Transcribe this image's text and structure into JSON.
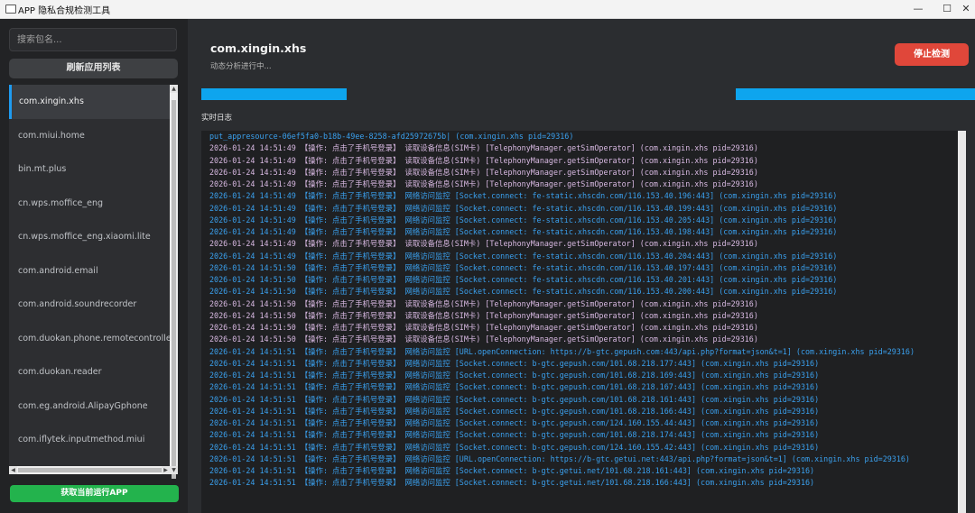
{
  "window": {
    "title": "APP 隐私合规检测工具",
    "controls": {
      "minimize": "—",
      "maximize": "☐",
      "close": "✕"
    }
  },
  "sidebar": {
    "search_placeholder": "搜索包名...",
    "refresh_label": "刷新应用列表",
    "apps": [
      "com.xingin.xhs",
      "com.miui.home",
      "bin.mt.plus",
      "cn.wps.moffice_eng",
      "cn.wps.moffice_eng.xiaomi.lite",
      "com.android.email",
      "com.android.soundrecorder",
      "com.duokan.phone.remotecontroller",
      "com.duokan.reader",
      "com.eg.android.AlipayGphone",
      "com.iflytek.inputmethod.miui"
    ],
    "selected_index": 0,
    "run_app_label": "获取当前运行APP"
  },
  "main": {
    "package": "com.xingin.xhs",
    "status": "动态分析进行中...",
    "stop_label": "停止检测",
    "log_label": "实时日志",
    "logs": [
      {
        "kind": "net",
        "text": "put_appresource-06ef5fa0-b18b-49ee-8258-afd25972675b| (com.xingin.xhs pid=29316)"
      },
      {
        "kind": "dev",
        "text": "2026-01-24 14:51:49 【操作: 点击了手机号登录】 读取设备信息(SIM卡) [TelephonyManager.getSimOperator] (com.xingin.xhs pid=29316)"
      },
      {
        "kind": "dev",
        "text": "2026-01-24 14:51:49 【操作: 点击了手机号登录】 读取设备信息(SIM卡) [TelephonyManager.getSimOperator] (com.xingin.xhs pid=29316)"
      },
      {
        "kind": "dev",
        "text": "2026-01-24 14:51:49 【操作: 点击了手机号登录】 读取设备信息(SIM卡) [TelephonyManager.getSimOperator] (com.xingin.xhs pid=29316)"
      },
      {
        "kind": "dev",
        "text": "2026-01-24 14:51:49 【操作: 点击了手机号登录】 读取设备信息(SIM卡) [TelephonyManager.getSimOperator] (com.xingin.xhs pid=29316)"
      },
      {
        "kind": "net",
        "text": "2026-01-24 14:51:49 【操作: 点击了手机号登录】 网络访问监控 [Socket.connect: fe-static.xhscdn.com/116.153.40.196:443] (com.xingin.xhs pid=29316)"
      },
      {
        "kind": "net",
        "text": "2026-01-24 14:51:49 【操作: 点击了手机号登录】 网络访问监控 [Socket.connect: fe-static.xhscdn.com/116.153.40.199:443] (com.xingin.xhs pid=29316)"
      },
      {
        "kind": "net",
        "text": "2026-01-24 14:51:49 【操作: 点击了手机号登录】 网络访问监控 [Socket.connect: fe-static.xhscdn.com/116.153.40.205:443] (com.xingin.xhs pid=29316)"
      },
      {
        "kind": "net",
        "text": "2026-01-24 14:51:49 【操作: 点击了手机号登录】 网络访问监控 [Socket.connect: fe-static.xhscdn.com/116.153.40.198:443] (com.xingin.xhs pid=29316)"
      },
      {
        "kind": "dev",
        "text": "2026-01-24 14:51:49 【操作: 点击了手机号登录】 读取设备信息(SIM卡) [TelephonyManager.getSimOperator] (com.xingin.xhs pid=29316)"
      },
      {
        "kind": "net",
        "text": "2026-01-24 14:51:49 【操作: 点击了手机号登录】 网络访问监控 [Socket.connect: fe-static.xhscdn.com/116.153.40.204:443] (com.xingin.xhs pid=29316)"
      },
      {
        "kind": "net",
        "text": "2026-01-24 14:51:50 【操作: 点击了手机号登录】 网络访问监控 [Socket.connect: fe-static.xhscdn.com/116.153.40.197:443] (com.xingin.xhs pid=29316)"
      },
      {
        "kind": "net",
        "text": "2026-01-24 14:51:50 【操作: 点击了手机号登录】 网络访问监控 [Socket.connect: fe-static.xhscdn.com/116.153.40.201:443] (com.xingin.xhs pid=29316)"
      },
      {
        "kind": "net",
        "text": "2026-01-24 14:51:50 【操作: 点击了手机号登录】 网络访问监控 [Socket.connect: fe-static.xhscdn.com/116.153.40.200:443] (com.xingin.xhs pid=29316)"
      },
      {
        "kind": "dev",
        "text": "2026-01-24 14:51:50 【操作: 点击了手机号登录】 读取设备信息(SIM卡) [TelephonyManager.getSimOperator] (com.xingin.xhs pid=29316)"
      },
      {
        "kind": "dev",
        "text": "2026-01-24 14:51:50 【操作: 点击了手机号登录】 读取设备信息(SIM卡) [TelephonyManager.getSimOperator] (com.xingin.xhs pid=29316)"
      },
      {
        "kind": "dev",
        "text": "2026-01-24 14:51:50 【操作: 点击了手机号登录】 读取设备信息(SIM卡) [TelephonyManager.getSimOperator] (com.xingin.xhs pid=29316)"
      },
      {
        "kind": "dev",
        "text": "2026-01-24 14:51:50 【操作: 点击了手机号登录】 读取设备信息(SIM卡) [TelephonyManager.getSimOperator] (com.xingin.xhs pid=29316)"
      },
      {
        "kind": "net",
        "wrap": true,
        "text": "2026-01-24 14:51:51 【操作: 点击了手机号登录】 网络访问监控 [URL.openConnection: https://b-gtc.gepush.com:443/api.php?format=json&t=1] (com.xingin.xhs pid=29316)"
      },
      {
        "kind": "net",
        "text": "2026-01-24 14:51:51 【操作: 点击了手机号登录】 网络访问监控 [Socket.connect: b-gtc.gepush.com/101.68.218.177:443] (com.xingin.xhs pid=29316)"
      },
      {
        "kind": "net",
        "text": "2026-01-24 14:51:51 【操作: 点击了手机号登录】 网络访问监控 [Socket.connect: b-gtc.gepush.com/101.68.218.169:443] (com.xingin.xhs pid=29316)"
      },
      {
        "kind": "net",
        "text": "2026-01-24 14:51:51 【操作: 点击了手机号登录】 网络访问监控 [Socket.connect: b-gtc.gepush.com/101.68.218.167:443] (com.xingin.xhs pid=29316)"
      },
      {
        "kind": "net",
        "text": "2026-01-24 14:51:51 【操作: 点击了手机号登录】 网络访问监控 [Socket.connect: b-gtc.gepush.com/101.68.218.161:443] (com.xingin.xhs pid=29316)"
      },
      {
        "kind": "net",
        "text": "2026-01-24 14:51:51 【操作: 点击了手机号登录】 网络访问监控 [Socket.connect: b-gtc.gepush.com/101.68.218.166:443] (com.xingin.xhs pid=29316)"
      },
      {
        "kind": "net",
        "text": "2026-01-24 14:51:51 【操作: 点击了手机号登录】 网络访问监控 [Socket.connect: b-gtc.gepush.com/124.160.155.44:443] (com.xingin.xhs pid=29316)"
      },
      {
        "kind": "net",
        "text": "2026-01-24 14:51:51 【操作: 点击了手机号登录】 网络访问监控 [Socket.connect: b-gtc.gepush.com/101.68.218.174:443] (com.xingin.xhs pid=29316)"
      },
      {
        "kind": "net",
        "text": "2026-01-24 14:51:51 【操作: 点击了手机号登录】 网络访问监控 [Socket.connect: b-gtc.gepush.com/124.160.155.42:443] (com.xingin.xhs pid=29316)"
      },
      {
        "kind": "net",
        "wrap": true,
        "text": "2026-01-24 14:51:51 【操作: 点击了手机号登录】 网络访问监控 [URL.openConnection: https://b-gtc.getui.net:443/api.php?format=json&t=1] (com.xingin.xhs pid=29316)"
      },
      {
        "kind": "net",
        "text": "2026-01-24 14:51:51 【操作: 点击了手机号登录】 网络访问监控 [Socket.connect: b-gtc.getui.net/101.68.218.161:443] (com.xingin.xhs pid=29316)"
      },
      {
        "kind": "net",
        "text": "2026-01-24 14:51:51 【操作: 点击了手机号登录】 网络访问监控 [Socket.connect: b-gtc.getui.net/101.68.218.166:443] (com.xingin.xhs pid=29316)"
      }
    ]
  },
  "colors": {
    "accent": "#0ea5ee",
    "stop": "#e0473a",
    "run": "#23b34d",
    "log_net": "#3aa0ee",
    "log_device": "#d8b9e2"
  }
}
